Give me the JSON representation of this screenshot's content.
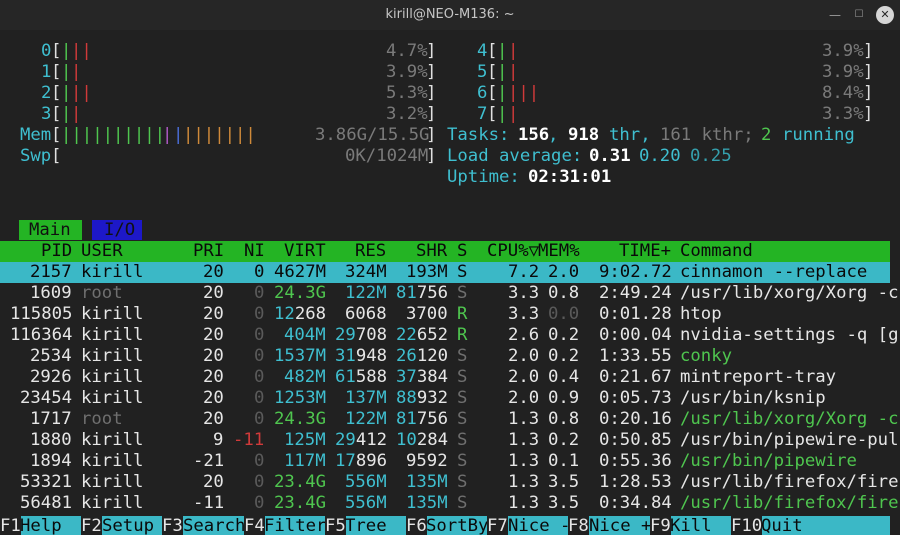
{
  "window": {
    "title": "kirill@NEO-M136: ~",
    "controls": [
      "minimize-icon",
      "maximize-icon",
      "close-icon"
    ]
  },
  "cpus": [
    {
      "id": "0",
      "bars": [
        [
          "#4fc64f",
          "|"
        ],
        [
          "#d03a3a",
          "||"
        ]
      ],
      "pct": "4.7%"
    },
    {
      "id": "1",
      "bars": [
        [
          "#4fc64f",
          "|"
        ],
        [
          "#d03a3a",
          "|"
        ]
      ],
      "pct": "3.9%"
    },
    {
      "id": "2",
      "bars": [
        [
          "#4fc64f",
          "|"
        ],
        [
          "#d03a3a",
          "||"
        ]
      ],
      "pct": "5.3%"
    },
    {
      "id": "3",
      "bars": [
        [
          "#4fc64f",
          "|"
        ],
        [
          "#d03a3a",
          "|"
        ]
      ],
      "pct": "3.2%"
    },
    {
      "id": "4",
      "bars": [
        [
          "#4fc64f",
          "|"
        ],
        [
          "#d03a3a",
          "|"
        ]
      ],
      "pct": "3.9%"
    },
    {
      "id": "5",
      "bars": [
        [
          "#4fc64f",
          "|"
        ],
        [
          "#d03a3a",
          "|"
        ]
      ],
      "pct": "3.9%"
    },
    {
      "id": "6",
      "bars": [
        [
          "#4fc64f",
          "|"
        ],
        [
          "#d03a3a",
          "|||"
        ]
      ],
      "pct": "8.4%"
    },
    {
      "id": "7",
      "bars": [
        [
          "#4fc64f",
          "|"
        ],
        [
          "#d03a3a",
          "|"
        ]
      ],
      "pct": "3.3%"
    }
  ],
  "mem": {
    "label": "Mem",
    "bars": [
      [
        "#4fc64f",
        "||||||||||"
      ],
      [
        "#b05ac8",
        "|"
      ],
      [
        "#4a6dd8",
        "|"
      ],
      [
        "#d08a3a",
        "|||||||"
      ]
    ],
    "value": "3.86G/15.5G"
  },
  "swp": {
    "label": "Swp",
    "value": "0K/1024M"
  },
  "tasks": {
    "label": "Tasks:",
    "count": "156",
    "threads": "918",
    "thr_label": "thr,",
    "kthr": "161 kthr;",
    "running": "2",
    "running_label": "running"
  },
  "load": {
    "label": "Load average:",
    "v1": "0.31",
    "v2": "0.20",
    "v3": "0.25"
  },
  "uptime": {
    "label": "Uptime:",
    "value": "02:31:01"
  },
  "tabs": {
    "main": "Main",
    "io": "I/O"
  },
  "columns": {
    "pid": "PID",
    "user": "USER",
    "pri": "PRI",
    "ni": "NI",
    "virt": "VIRT",
    "res": "RES",
    "shr": "SHR",
    "s": "S",
    "cpu": "CPU%▽",
    "mem": "MEM%",
    "time": "TIME+",
    "cmd": "Command"
  },
  "rows": [
    {
      "pid": "2157",
      "user": "kirill",
      "pri": "20",
      "ni": "0",
      "virt": "4627M",
      "res": "324M",
      "shr": "193M",
      "s": "S",
      "cpu": "7.2",
      "mem": "2.0",
      "time": "9:02.72",
      "cmd": "cinnamon --replace",
      "selected": true
    },
    {
      "pid": "1609",
      "user": "root",
      "pri": "20",
      "ni": "0",
      "virt": "24.3G",
      "res": "122M",
      "shr": "81756",
      "s": "S",
      "cpu": "3.3",
      "mem": "0.8",
      "time": "2:49.24",
      "cmd": "/usr/lib/xorg/Xorg -c"
    },
    {
      "pid": "115805",
      "user": "kirill",
      "pri": "20",
      "ni": "0",
      "virt": "12268",
      "res": "6068",
      "shr": "3700",
      "s": "R",
      "cpu": "3.3",
      "mem": "0.0",
      "time": "0:01.28",
      "cmd": "htop"
    },
    {
      "pid": "116364",
      "user": "kirill",
      "pri": "20",
      "ni": "0",
      "virt": "404M",
      "res": "29708",
      "shr": "22652",
      "s": "R",
      "cpu": "2.6",
      "mem": "0.2",
      "time": "0:00.04",
      "cmd": "nvidia-settings -q [g"
    },
    {
      "pid": "2534",
      "user": "kirill",
      "pri": "20",
      "ni": "0",
      "virt": "1537M",
      "res": "31948",
      "shr": "26120",
      "s": "S",
      "cpu": "2.0",
      "mem": "0.2",
      "time": "1:33.55",
      "cmd": "conky",
      "cmdColor": "#4fc64f"
    },
    {
      "pid": "2926",
      "user": "kirill",
      "pri": "20",
      "ni": "0",
      "virt": "482M",
      "res": "61588",
      "shr": "37384",
      "s": "S",
      "cpu": "2.0",
      "mem": "0.4",
      "time": "0:21.67",
      "cmd": "mintreport-tray"
    },
    {
      "pid": "23454",
      "user": "kirill",
      "pri": "20",
      "ni": "0",
      "virt": "1253M",
      "res": "137M",
      "shr": "88932",
      "s": "S",
      "cpu": "2.0",
      "mem": "0.9",
      "time": "0:05.73",
      "cmd": "/usr/bin/ksnip"
    },
    {
      "pid": "1717",
      "user": "root",
      "pri": "20",
      "ni": "0",
      "virt": "24.3G",
      "res": "122M",
      "shr": "81756",
      "s": "S",
      "cpu": "1.3",
      "mem": "0.8",
      "time": "0:20.16",
      "cmd": "/usr/lib/xorg/Xorg -c",
      "cmdColor": "#4fc64f"
    },
    {
      "pid": "1880",
      "user": "kirill",
      "pri": "9",
      "ni": "-11",
      "virt": "125M",
      "res": "29412",
      "shr": "10284",
      "s": "S",
      "cpu": "1.3",
      "mem": "0.2",
      "time": "0:50.85",
      "cmd": "/usr/bin/pipewire-pul",
      "niColor": "#d03a3a"
    },
    {
      "pid": "1894",
      "user": "kirill",
      "pri": "-21",
      "ni": "0",
      "virt": "117M",
      "res": "17896",
      "shr": "9592",
      "s": "S",
      "cpu": "1.3",
      "mem": "0.1",
      "time": "0:55.36",
      "cmd": "/usr/bin/pipewire",
      "cmdColor": "#4fc64f"
    },
    {
      "pid": "53321",
      "user": "kirill",
      "pri": "20",
      "ni": "0",
      "virt": "23.4G",
      "res": "556M",
      "shr": "135M",
      "s": "S",
      "cpu": "1.3",
      "mem": "3.5",
      "time": "1:28.53",
      "cmd": "/usr/lib/firefox/fire"
    },
    {
      "pid": "56481",
      "user": "kirill",
      "pri": "-11",
      "ni": "0",
      "virt": "23.4G",
      "res": "556M",
      "shr": "135M",
      "s": "S",
      "cpu": "1.3",
      "mem": "3.5",
      "time": "0:34.84",
      "cmd": "/usr/lib/firefox/fire",
      "cmdColor": "#4fc64f"
    }
  ],
  "footer": [
    {
      "key": "F1",
      "label": "Help"
    },
    {
      "key": "F2",
      "label": "Setup"
    },
    {
      "key": "F3",
      "label": "Search"
    },
    {
      "key": "F4",
      "label": "Filter"
    },
    {
      "key": "F5",
      "label": "Tree"
    },
    {
      "key": "F6",
      "label": "SortBy"
    },
    {
      "key": "F7",
      "label": "Nice -"
    },
    {
      "key": "F8",
      "label": "Nice +"
    },
    {
      "key": "F9",
      "label": "Kill"
    },
    {
      "key": "F10",
      "label": "Quit"
    }
  ]
}
